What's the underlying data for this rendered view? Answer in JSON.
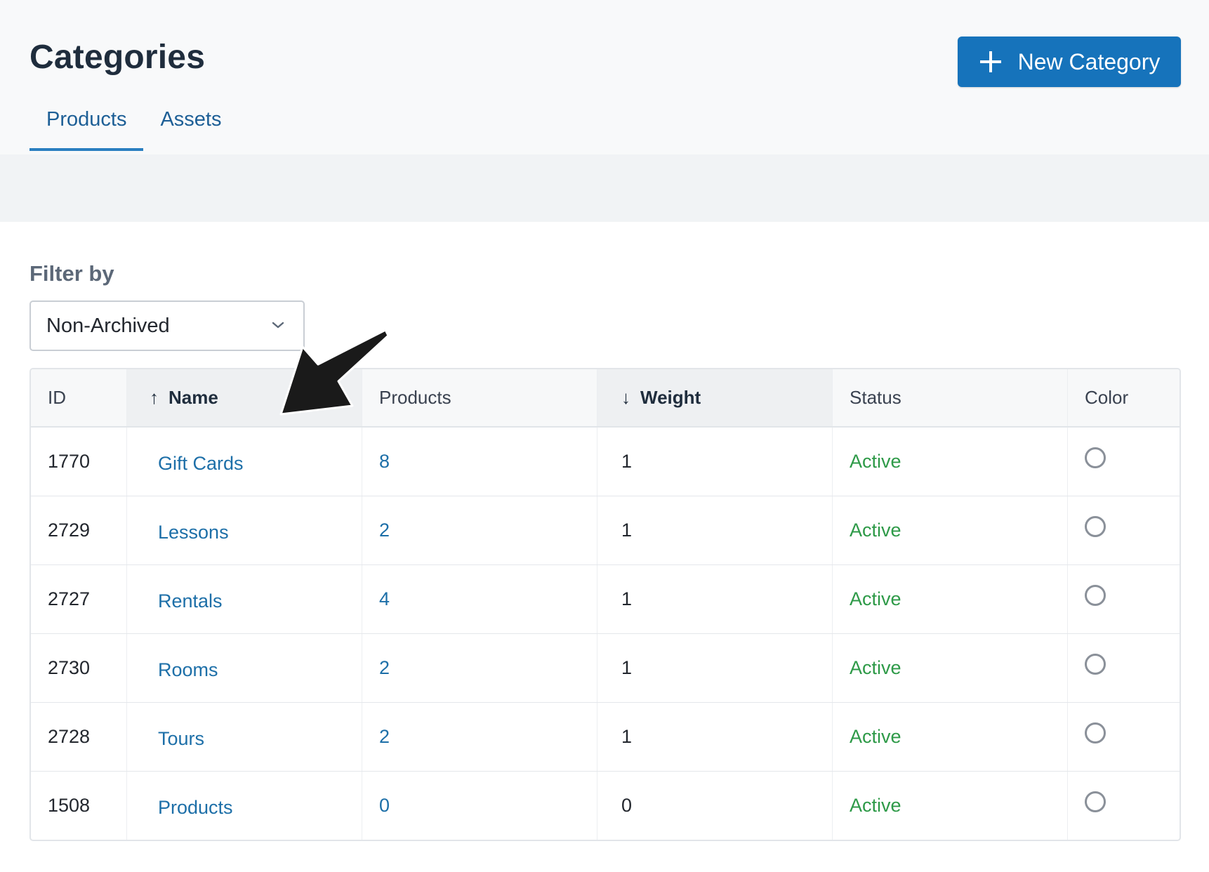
{
  "header": {
    "title": "Categories",
    "new_button_label": "New Category",
    "tabs": [
      {
        "label": "Products",
        "active": true
      },
      {
        "label": "Assets",
        "active": false
      }
    ]
  },
  "filter": {
    "label": "Filter by",
    "selected": "Non-Archived"
  },
  "table": {
    "columns": {
      "id": "ID",
      "name": "Name",
      "products": "Products",
      "weight": "Weight",
      "status": "Status",
      "color": "Color"
    },
    "sort": {
      "name_arrow": "↑",
      "weight_arrow": "↓"
    },
    "rows": [
      {
        "id": "1770",
        "name": "Gift Cards",
        "products": "8",
        "weight": "1",
        "status": "Active"
      },
      {
        "id": "2729",
        "name": "Lessons",
        "products": "2",
        "weight": "1",
        "status": "Active"
      },
      {
        "id": "2727",
        "name": "Rentals",
        "products": "4",
        "weight": "1",
        "status": "Active"
      },
      {
        "id": "2730",
        "name": "Rooms",
        "products": "2",
        "weight": "1",
        "status": "Active"
      },
      {
        "id": "2728",
        "name": "Tours",
        "products": "2",
        "weight": "1",
        "status": "Active"
      },
      {
        "id": "1508",
        "name": "Products",
        "products": "0",
        "weight": "0",
        "status": "Active"
      }
    ]
  },
  "colors": {
    "primary": "#1673bb",
    "link": "#1d6fa8",
    "active_status": "#2e9a48",
    "annotation_arrow": "#1a1a1a"
  },
  "icons": {
    "new_button": "plus-icon",
    "select": "chevron-down-icon",
    "annotation": "arrow-annotation"
  }
}
